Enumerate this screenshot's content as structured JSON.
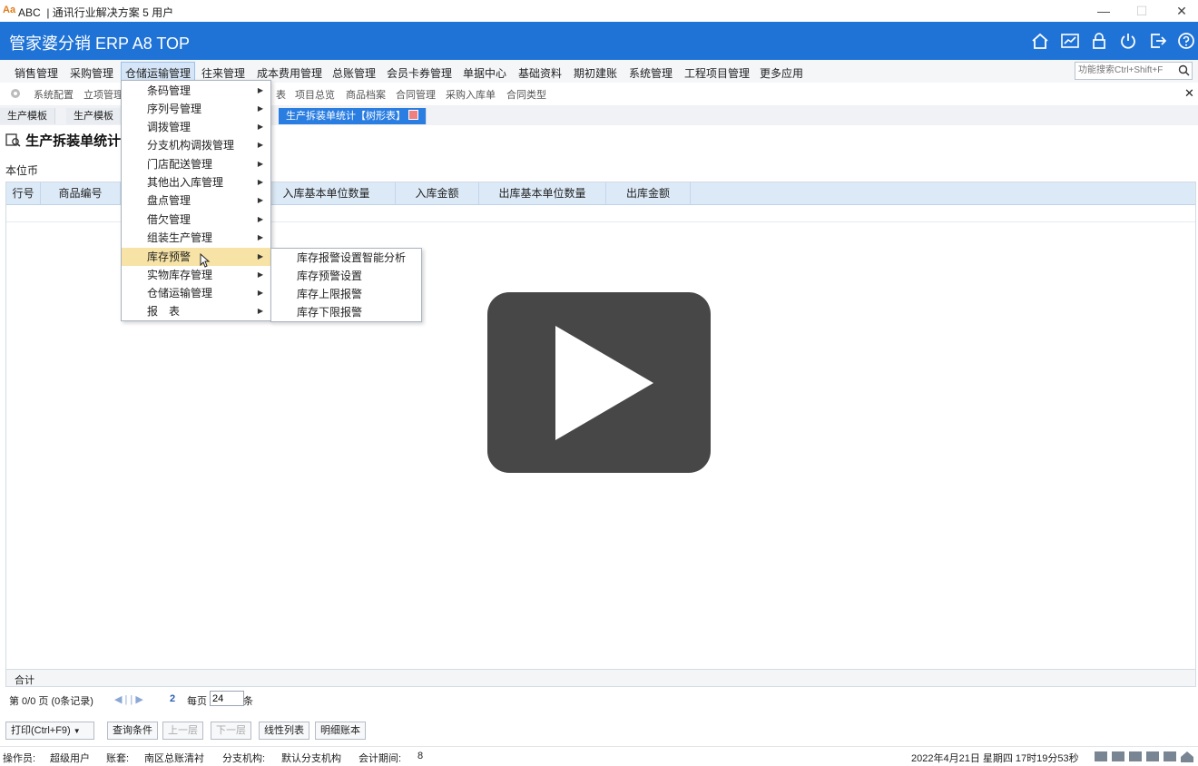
{
  "window": {
    "logo": "Aa",
    "app": "ABC",
    "title": "| 通讯行业解决方案 5 用户",
    "min": "—",
    "max": "☐",
    "close": "✕"
  },
  "header": {
    "brand": "管家婆分销 ERP A8 TOP"
  },
  "menubar": {
    "items": [
      "销售管理",
      "采购管理",
      "仓储运输管理",
      "往来管理",
      "成本费用管理",
      "总账管理",
      "会员卡券管理",
      "单据中心",
      "基础资料",
      "期初建账",
      "系统管理",
      "工程项目管理",
      "更多应用"
    ],
    "active": "仓储运输管理",
    "search_placeholder": "功能搜索Ctrl+Shift+F"
  },
  "quickbar": {
    "items": [
      "系统配置",
      "立项管理",
      "表",
      "项目总览",
      "商品档案",
      "合同管理",
      "采购入库单",
      "合同类型"
    ],
    "close": "✕"
  },
  "tabs": [
    "生产模板",
    "生产模板",
    "生产拆装单统计【树形表】"
  ],
  "page": {
    "title": "生产拆装单统计",
    "currency": "本位币"
  },
  "table": {
    "columns": [
      "行号",
      "商品编号",
      "入库基本单位数量",
      "入库金额",
      "出库基本单位数量",
      "出库金额"
    ],
    "sum_label": "合计"
  },
  "pager": {
    "page_info": "第 0/0 页 (0条记录)",
    "nav": "◀ | | ▶",
    "page_num": "2",
    "per_page_label": "每页",
    "per_page_value": "24",
    "unit": "条"
  },
  "buttons": [
    {
      "label": "打印(Ctrl+F9)",
      "enabled": true
    },
    {
      "label": "查询条件",
      "enabled": true
    },
    {
      "label": "上一层",
      "enabled": false
    },
    {
      "label": "下一层",
      "enabled": false
    },
    {
      "label": "线性列表",
      "enabled": true
    },
    {
      "label": "明细账本",
      "enabled": true
    }
  ],
  "status": {
    "operator_label": "操作员:",
    "operator": "超级用户",
    "account_label": "账套:",
    "account": "南区总账清衬",
    "branch_label": "分支机构:",
    "branch": "默认分支机构",
    "period_label": "会计期间:",
    "period": "8",
    "datetime": "2022年4月21日 星期四 17时19分53秒"
  },
  "dropdown": {
    "items": [
      "条码管理",
      "序列号管理",
      "调拨管理",
      "分支机构调拨管理",
      "门店配送管理",
      "其他出入库管理",
      "盘点管理",
      "借欠管理",
      "组装生产管理",
      "库存预警",
      "实物库存管理",
      "仓储运输管理",
      "报　表"
    ],
    "highlighted": "库存预警"
  },
  "submenu": {
    "items": [
      "库存报警设置智能分析",
      "库存预警设置",
      "库存上限报警",
      "库存下限报警"
    ]
  },
  "colors": {
    "header": "#1f73d6",
    "highlight": "#f6e3a5",
    "table_header": "#dce9f7"
  }
}
